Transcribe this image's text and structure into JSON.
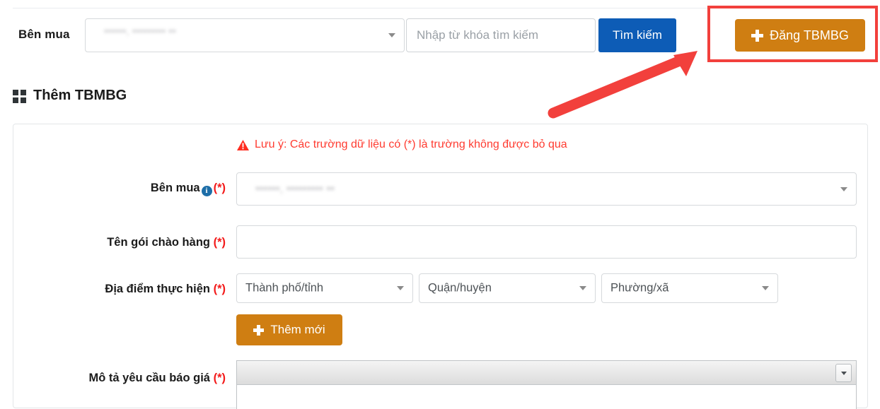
{
  "search_bar": {
    "label": "Bên mua",
    "buyer_select_value": "••••••, ••••••••• ••",
    "keyword_placeholder": "Nhập từ khóa tìm kiếm",
    "search_button": "Tìm kiếm",
    "post_button": "Đăng TBMBG",
    "post_button_color": "#cf7e12",
    "search_button_color": "#0d5cb6",
    "highlight_color": "#f2403c"
  },
  "section": {
    "title": "Thêm TBMBG",
    "icon": "grid-icon"
  },
  "form": {
    "note": "Lưu ý: Các trường dữ liệu có (*) là trường không được bỏ qua",
    "note_color": "#ff3b30",
    "required_mark": "(*)",
    "rows": {
      "buyer": {
        "label": "Bên mua",
        "info_icon": "info-icon",
        "value": "••••••, ••••••••• ••"
      },
      "package_name": {
        "label": "Tên gói chào hàng",
        "value": ""
      },
      "location": {
        "label": "Địa điểm thực hiện",
        "province_placeholder": "Thành phố/tỉnh",
        "district_placeholder": "Quận/huyện",
        "ward_placeholder": "Phường/xã",
        "add_button": "Thêm mới"
      },
      "description": {
        "label": "Mô tả yêu cầu báo giá",
        "editor_content": ""
      }
    }
  }
}
